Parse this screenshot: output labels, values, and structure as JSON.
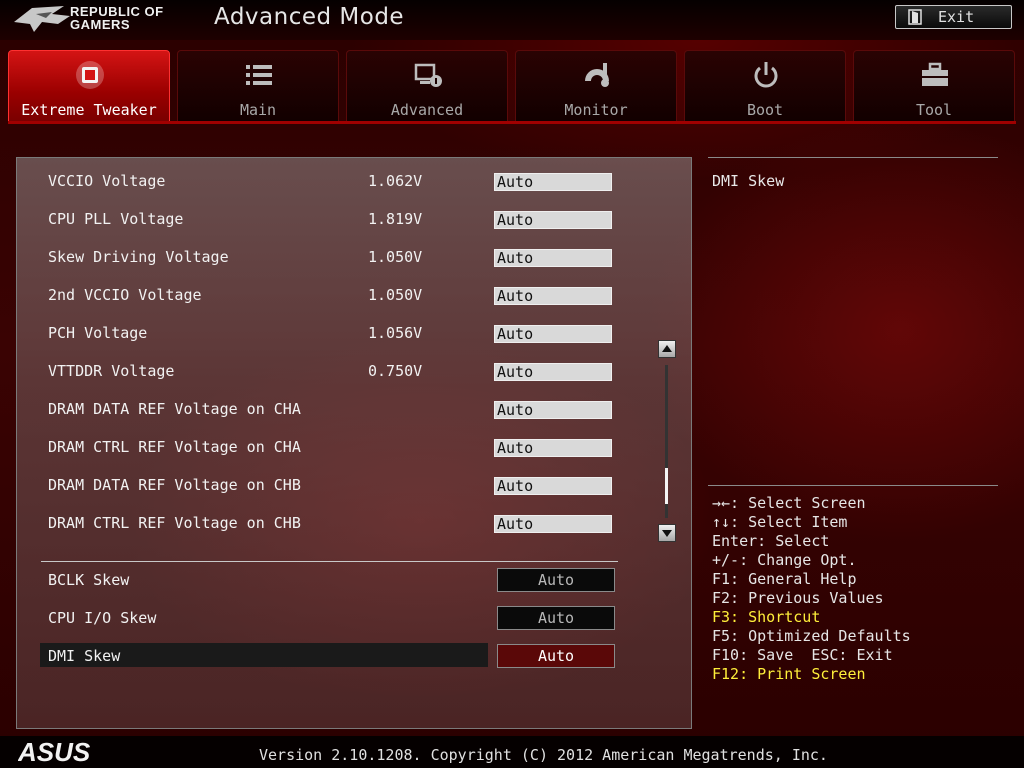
{
  "header": {
    "brand_line1": "REPUBLIC OF",
    "brand_line2": "GAMERS",
    "mode_title": "Advanced Mode",
    "exit_label": "Exit"
  },
  "tabs": [
    {
      "label": "Extreme Tweaker",
      "icon": "cpu-chip-icon",
      "active": true
    },
    {
      "label": "Main",
      "icon": "list-icon"
    },
    {
      "label": "Advanced",
      "icon": "settings-monitor-icon"
    },
    {
      "label": "Monitor",
      "icon": "gauge-icon"
    },
    {
      "label": "Boot",
      "icon": "power-icon"
    },
    {
      "label": "Tool",
      "icon": "toolbox-icon"
    }
  ],
  "voltage_rows": [
    {
      "name": "VCCIO Voltage",
      "value": "1.062V",
      "setting": "Auto"
    },
    {
      "name": "CPU PLL Voltage",
      "value": "1.819V",
      "setting": "Auto"
    },
    {
      "name": "Skew Driving Voltage",
      "value": "1.050V",
      "setting": "Auto"
    },
    {
      "name": "2nd VCCIO Voltage",
      "value": "1.050V",
      "setting": "Auto"
    },
    {
      "name": "PCH Voltage",
      "value": "1.056V",
      "setting": "Auto"
    },
    {
      "name": "VTTDDR Voltage",
      "value": "0.750V",
      "setting": "Auto"
    },
    {
      "name": "DRAM DATA REF Voltage on CHA",
      "value": "",
      "setting": "Auto"
    },
    {
      "name": "DRAM CTRL REF Voltage on CHA",
      "value": "",
      "setting": "Auto"
    },
    {
      "name": "DRAM DATA REF Voltage on CHB",
      "value": "",
      "setting": "Auto"
    },
    {
      "name": "DRAM CTRL REF Voltage on CHB",
      "value": "",
      "setting": "Auto"
    }
  ],
  "skew_rows": [
    {
      "name": "BCLK Skew",
      "setting": "Auto"
    },
    {
      "name": "CPU I/O Skew",
      "setting": "Auto"
    },
    {
      "name": "DMI Skew",
      "setting": "Auto",
      "selected": true
    }
  ],
  "help": {
    "title": "DMI Skew",
    "keys": [
      {
        "text": "→←: Select Screen"
      },
      {
        "text": "↑↓: Select Item"
      },
      {
        "text": "Enter: Select"
      },
      {
        "text": "+/-: Change Opt."
      },
      {
        "text": "F1: General Help"
      },
      {
        "text": "F2: Previous Values"
      },
      {
        "text": "F3: Shortcut",
        "highlight": true
      },
      {
        "text": "F5: Optimized Defaults"
      },
      {
        "text": "F10: Save  ESC: Exit"
      },
      {
        "text": "F12: Print Screen",
        "highlight": true
      }
    ]
  },
  "footer": {
    "logo": "ASUS",
    "version": "Version 2.10.1208. Copyright (C) 2012 American Megatrends, Inc."
  },
  "colors": {
    "accent": "#c80000",
    "highlight_text": "#ffef3a"
  }
}
